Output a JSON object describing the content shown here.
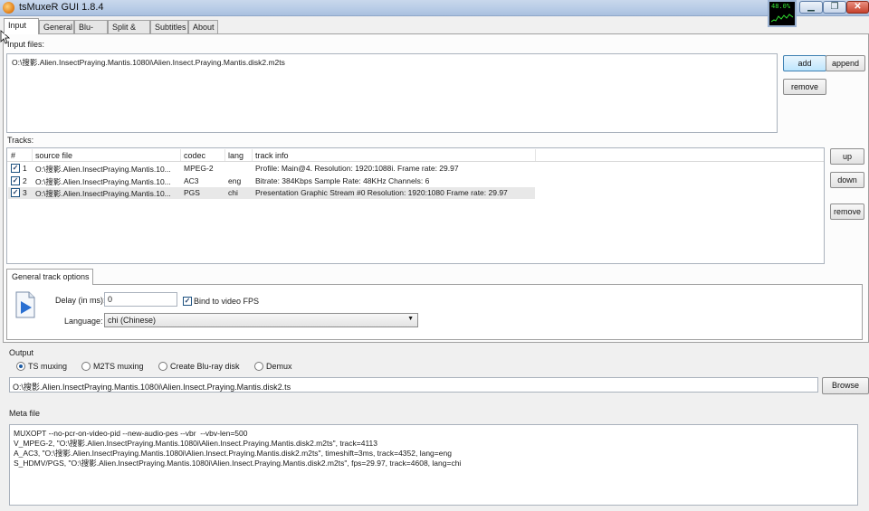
{
  "window": {
    "title": "tsMuxeR GUI 1.8.4",
    "cpu_meter": "48.0%",
    "minimize": "▁",
    "maximize": "❐",
    "close": "✕"
  },
  "tabs": [
    "Input",
    "General",
    "Blu-ray",
    "Split & cut",
    "Subtitles",
    "About"
  ],
  "input_files": {
    "label": "Input files:",
    "files": [
      "O:\\搜影.Alien.InsectPraying.Mantis.1080i\\Alien.Insect.Praying.Mantis.disk2.m2ts"
    ],
    "add": "add",
    "append": "append",
    "remove": "remove"
  },
  "tracks": {
    "label": "Tracks:",
    "headers": [
      "#",
      "source file",
      "codec",
      "lang",
      "track info"
    ],
    "rows": [
      {
        "checked": "✓",
        "num": "1",
        "source": "O:\\搜影.Alien.InsectPraying.Mantis.10...",
        "codec": "MPEG-2",
        "lang": "",
        "info": "Profile: Main@4. Resolution: 1920:1088i. Frame rate: 29.97"
      },
      {
        "checked": "✓",
        "num": "2",
        "source": "O:\\搜影.Alien.InsectPraying.Mantis.10...",
        "codec": "AC3",
        "lang": "eng",
        "info": "Bitrate: 384Kbps Sample Rate: 48KHz Channels: 6"
      },
      {
        "checked": "✓",
        "num": "3",
        "source": "O:\\搜影.Alien.InsectPraying.Mantis.10...",
        "codec": "PGS",
        "lang": "chi",
        "info": "Presentation Graphic Stream #0 Resolution: 1920:1080 Frame rate: 29.97"
      }
    ],
    "up": "up",
    "down": "down",
    "remove": "remove"
  },
  "track_options": {
    "tab": "General track options",
    "delay_label": "Delay (in ms):",
    "delay_value": "0",
    "bind_fps_label": "Bind to video FPS",
    "bind_fps_checked": "✓",
    "language_label": "Language:",
    "language_value": "chi (Chinese)"
  },
  "output": {
    "label": "Output",
    "modes": [
      "TS muxing",
      "M2TS muxing",
      "Create Blu-ray disk",
      "Demux"
    ],
    "selected": "TS muxing",
    "path": "O:\\搜影.Alien.InsectPraying.Mantis.1080i\\Alien.Insect.Praying.Mantis.disk2.ts",
    "browse": "Browse"
  },
  "meta": {
    "label": "Meta file",
    "lines": [
      "MUXOPT --no-pcr-on-video-pid --new-audio-pes --vbr  --vbv-len=500",
      "V_MPEG-2, \"O:\\搜影.Alien.InsectPraying.Mantis.1080i\\Alien.Insect.Praying.Mantis.disk2.m2ts\", track=4113",
      "A_AC3, \"O:\\搜影.Alien.InsectPraying.Mantis.1080i\\Alien.Insect.Praying.Mantis.disk2.m2ts\", timeshift=3ms, track=4352, lang=eng",
      "S_HDMV/PGS, \"O:\\搜影.Alien.InsectPraying.Mantis.1080i\\Alien.Insect.Praying.Mantis.disk2.m2ts\", fps=29.97, track=4608, lang=chi"
    ]
  }
}
